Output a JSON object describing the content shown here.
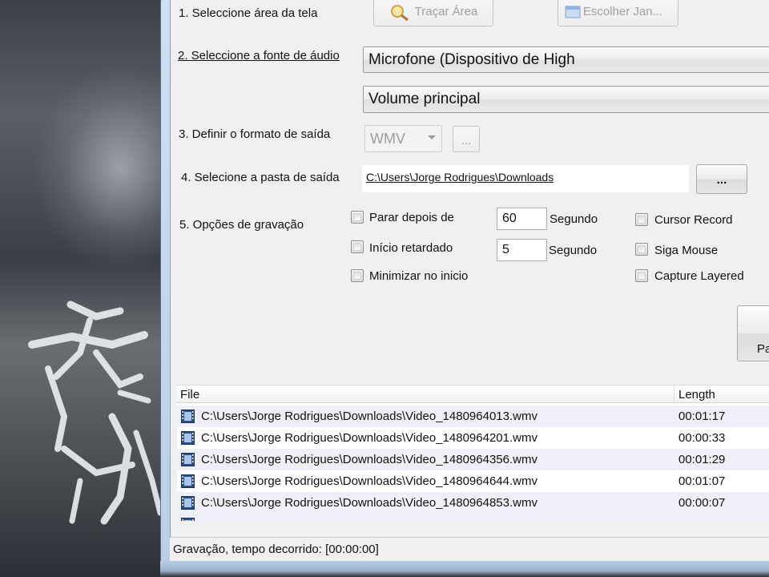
{
  "steps": {
    "area_label": "1. Seleccione área da tela",
    "trace_area_button": "Traçar Área",
    "choose_window_button": "Escolher Jan...",
    "audio_label": "2. Seleccione a fonte de áudio",
    "audio_source": "Microfone (Dispositivo de High",
    "volume_source": "Volume principal",
    "format_label": "3. Definir o formato de saída",
    "format_value": "WMV",
    "format_options_button": "...",
    "folder_label": "4. Selecione a pasta de saída",
    "folder_path": "C:\\Users\\Jorge Rodrigues\\Downloads",
    "browse_button": "...",
    "options_label": "5. Opções de gravação"
  },
  "options": {
    "stop_after_label": "Parar depois de",
    "stop_after_value": "60",
    "stop_after_unit": "Segundo",
    "delay_label": "Início retardado",
    "delay_value": "5",
    "delay_unit": "Segundo",
    "minimize_label": "Minimizar no inicio",
    "cursor_record_label": "Cursor Record",
    "follow_mouse_label": "Siga Mouse",
    "capture_layered_label": "Capture Layered",
    "record_button_partial": "Pa"
  },
  "file_list": {
    "columns": [
      "File",
      "Length"
    ],
    "rows": [
      {
        "file": "C:\\Users\\Jorge Rodrigues\\Downloads\\Video_1480964013.wmv",
        "length": "00:01:17"
      },
      {
        "file": "C:\\Users\\Jorge Rodrigues\\Downloads\\Video_1480964201.wmv",
        "length": "00:00:33"
      },
      {
        "file": "C:\\Users\\Jorge Rodrigues\\Downloads\\Video_1480964356.wmv",
        "length": "00:01:29"
      },
      {
        "file": "C:\\Users\\Jorge Rodrigues\\Downloads\\Video_1480964644.wmv",
        "length": "00:01:07"
      },
      {
        "file": "C:\\Users\\Jorge Rodrigues\\Downloads\\Video_1480964853.wmv",
        "length": "00:00:07"
      }
    ]
  },
  "status": {
    "text": "Gravação, tempo decorrido: [00:00:00]"
  }
}
